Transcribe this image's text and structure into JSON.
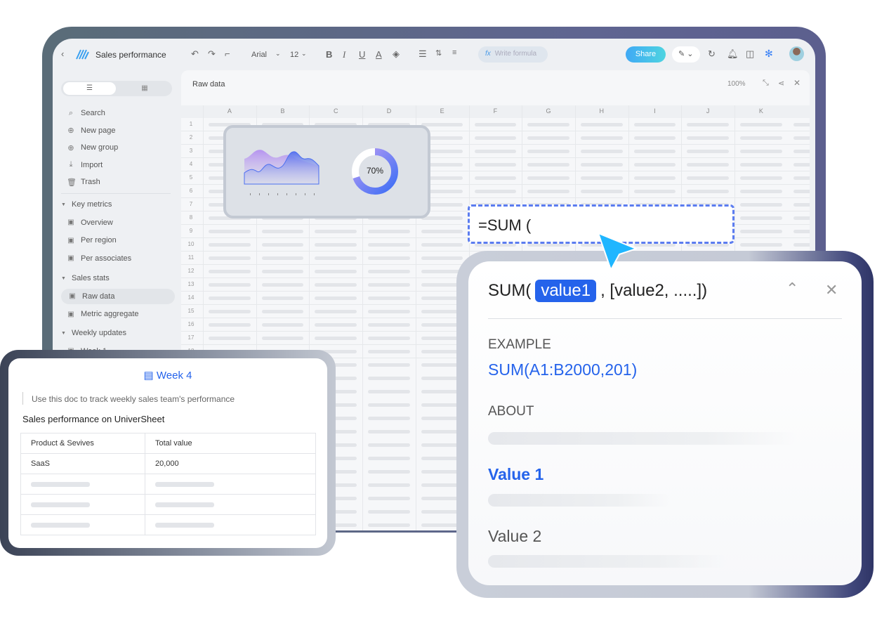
{
  "app": {
    "title": "Sales performance"
  },
  "toolbar": {
    "font": "Arial",
    "size": "12",
    "formula_placeholder": "Write formula",
    "share": "Share"
  },
  "sidebar": {
    "actions": [
      {
        "label": "Search",
        "icon": "search-icon"
      },
      {
        "label": "New page",
        "icon": "plus-circle-icon"
      },
      {
        "label": "New group",
        "icon": "plus-circle-icon"
      },
      {
        "label": "Import",
        "icon": "download-icon"
      },
      {
        "label": "Trash",
        "icon": "trash-icon"
      }
    ],
    "groups": [
      {
        "label": "Key metrics",
        "items": [
          "Overview",
          "Per region",
          "Per associates"
        ]
      },
      {
        "label": "Sales stats",
        "items": [
          "Raw data",
          "Metric aggregate"
        ]
      },
      {
        "label": "Weekly updates",
        "items": [
          "Week 1"
        ]
      }
    ]
  },
  "sheet": {
    "title": "Raw data",
    "zoom": "100%",
    "columns": [
      "A",
      "B",
      "C",
      "D",
      "E",
      "F",
      "G",
      "H",
      "I",
      "J",
      "K"
    ],
    "rows": [
      "1",
      "2",
      "3",
      "4",
      "5",
      "6",
      "7",
      "8",
      "9",
      "10",
      "11",
      "12",
      "13",
      "14",
      "15",
      "16",
      "17",
      "18"
    ]
  },
  "chart_card": {
    "donut_label": "70%",
    "donut_value": 70,
    "colors": {
      "purple": "#b79cf3",
      "blue": "#3d6ef5"
    }
  },
  "formula": {
    "input": "=SUM ("
  },
  "popup": {
    "fn": "SUM(",
    "arg1": "value1",
    "rest": ", [value2, .....])",
    "example_label": "EXAMPLE",
    "example": "SUM(A1:B2000,201)",
    "about_label": "ABOUT",
    "value1": "Value 1",
    "value2": "Value 2",
    "accent": "#2563eb"
  },
  "week": {
    "title": "Week 4",
    "quote": "Use this doc to track weekly sales team's performance",
    "heading": "Sales performance on UniverSheet",
    "headers": [
      "Product & Sevives",
      "Total value"
    ],
    "rows": [
      [
        "SaaS",
        "20,000"
      ]
    ]
  }
}
